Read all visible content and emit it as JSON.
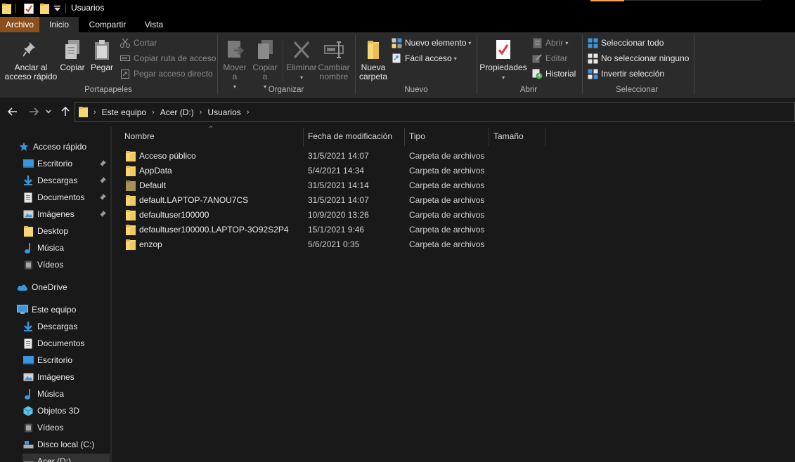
{
  "window": {
    "title": "Usuarios"
  },
  "quick_access_toolbar": {
    "icons": [
      "folder-icon",
      "properties-icon",
      "new-folder-icon",
      "customize-dropdown-icon"
    ]
  },
  "menu_tabs": [
    {
      "label": "Archivo"
    },
    {
      "label": "Inicio"
    },
    {
      "label": "Compartir"
    },
    {
      "label": "Vista"
    }
  ],
  "ribbon": {
    "portapapeles": {
      "label": "Portapapeles",
      "pin": "Anclar al acceso rápido",
      "copy": "Copiar",
      "paste": "Pegar",
      "cut": "Cortar",
      "copy_path": "Copiar ruta de acceso",
      "paste_shortcut": "Pegar acceso directo"
    },
    "organizar": {
      "label": "Organizar",
      "move_to": "Mover a",
      "copy_to": "Copiar a",
      "delete": "Eliminar",
      "rename": "Cambiar nombre"
    },
    "nuevo": {
      "label": "Nuevo",
      "new_folder": "Nueva carpeta",
      "new_item": "Nuevo elemento",
      "easy_access": "Fácil acceso"
    },
    "abrir": {
      "label": "Abrir",
      "properties": "Propiedades",
      "open": "Abrir",
      "edit": "Editar",
      "history": "Historial"
    },
    "seleccionar": {
      "label": "Seleccionar",
      "select_all": "Seleccionar todo",
      "select_none": "No seleccionar ninguno",
      "invert": "Invertir selección"
    }
  },
  "address_bar": {
    "crumbs": [
      "Este equipo",
      "Acer (D:)",
      "Usuarios"
    ]
  },
  "sidebar": {
    "quick_access": {
      "label": "Acceso rápido"
    },
    "quick_items": [
      {
        "label": "Escritorio"
      },
      {
        "label": "Descargas"
      },
      {
        "label": "Documentos"
      },
      {
        "label": "Imágenes"
      },
      {
        "label": "Desktop"
      },
      {
        "label": "Música"
      },
      {
        "label": "Vídeos"
      }
    ],
    "onedrive": {
      "label": "OneDrive"
    },
    "this_pc": {
      "label": "Este equipo"
    },
    "pc_items": [
      {
        "label": "Descargas"
      },
      {
        "label": "Documentos"
      },
      {
        "label": "Escritorio"
      },
      {
        "label": "Imágenes"
      },
      {
        "label": "Música"
      },
      {
        "label": "Objetos 3D"
      },
      {
        "label": "Vídeos"
      },
      {
        "label": "Disco local (C:)"
      },
      {
        "label": "Acer (D:)"
      }
    ]
  },
  "file_list": {
    "columns": [
      "Nombre",
      "Fecha de modificación",
      "Tipo",
      "Tamaño"
    ],
    "rows": [
      {
        "name": "Acceso público",
        "date": "31/5/2021 14:07",
        "type": "Carpeta de archivos",
        "size": ""
      },
      {
        "name": "AppData",
        "date": "5/4/2021 14:34",
        "type": "Carpeta de archivos",
        "size": ""
      },
      {
        "name": "Default",
        "date": "31/5/2021 14:14",
        "type": "Carpeta de archivos",
        "size": ""
      },
      {
        "name": "default.LAPTOP-7ANOU7CS",
        "date": "31/5/2021 14:07",
        "type": "Carpeta de archivos",
        "size": ""
      },
      {
        "name": "defaultuser100000",
        "date": "10/9/2020 13:26",
        "type": "Carpeta de archivos",
        "size": ""
      },
      {
        "name": "defaultuser100000.LAPTOP-3O92S2P4",
        "date": "15/1/2021 9:46",
        "type": "Carpeta de archivos",
        "size": ""
      },
      {
        "name": "enzop",
        "date": "5/6/2021 0:35",
        "type": "Carpeta de archivos",
        "size": ""
      }
    ]
  },
  "colors": {
    "folder": "#f8d775",
    "file_tab": "#8a4f1c",
    "accent_blue": "#3a96dd"
  }
}
